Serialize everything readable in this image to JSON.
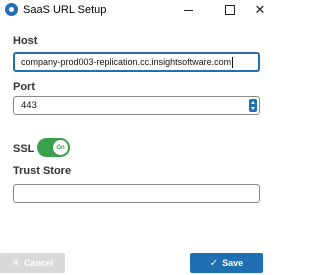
{
  "window": {
    "title": "SaaS URL Setup",
    "minimize_label": "",
    "close_label": "✕"
  },
  "form": {
    "host_label": "Host",
    "host_value": "company-prod003-replication.cc.insightsoftware.com",
    "port_label": "Port",
    "port_value": "443",
    "ssl_label": "SSL",
    "ssl_toggle_text": "On",
    "ssl_enabled": true,
    "trust_store_label": "Trust Store",
    "trust_store_value": ""
  },
  "footer": {
    "cancel_label": "Cancel",
    "cancel_icon": "✕",
    "save_label": "Save",
    "save_icon": "✓"
  },
  "colors": {
    "accent": "#1f6fb2",
    "toggle_on": "#3aa04a",
    "disabled_button": "#d9d9d9"
  }
}
